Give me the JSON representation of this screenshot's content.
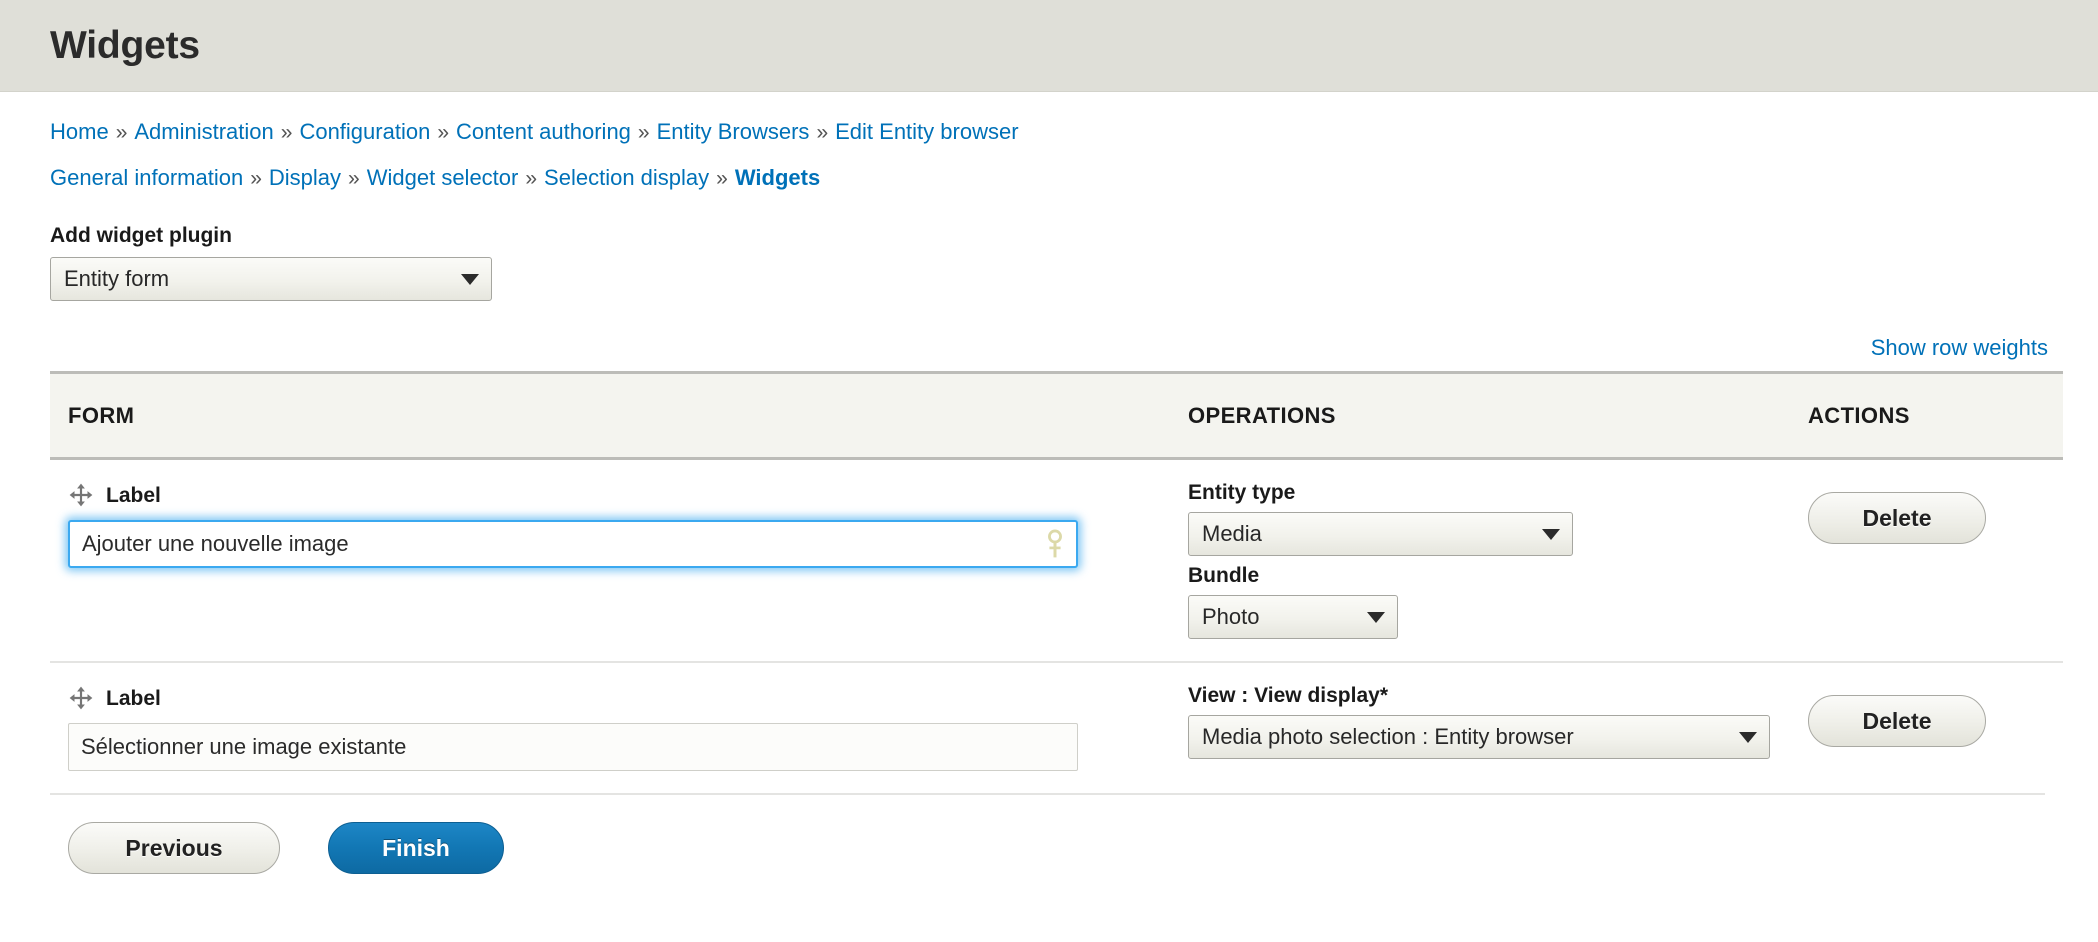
{
  "header": {
    "title": "Widgets"
  },
  "breadcrumb": {
    "separator": "»",
    "row1": [
      {
        "label": "Home",
        "current": false
      },
      {
        "label": "Administration",
        "current": false
      },
      {
        "label": "Configuration",
        "current": false
      },
      {
        "label": "Content authoring",
        "current": false
      },
      {
        "label": "Entity Browsers",
        "current": false
      },
      {
        "label": "Edit Entity browser",
        "current": false
      }
    ],
    "row2": [
      {
        "label": "General information",
        "current": false
      },
      {
        "label": "Display",
        "current": false
      },
      {
        "label": "Widget selector",
        "current": false
      },
      {
        "label": "Selection display",
        "current": false
      },
      {
        "label": "Widgets",
        "current": true
      }
    ]
  },
  "add_widget": {
    "label": "Add widget plugin",
    "select_value": "Entity form",
    "icon": "chevron-down-icon"
  },
  "table": {
    "show_row_weights": "Show row weights",
    "columns": [
      "FORM",
      "OPERATIONS",
      "ACTIONS"
    ],
    "rows": [
      {
        "drag_icon": "move-handle-icon",
        "label_text": "Label",
        "input_value": "Ajouter une nouvelle image",
        "input_placeholder": "",
        "input_focused": true,
        "autofill_icon": "key-icon",
        "operations": [
          {
            "label": "Entity type",
            "required": false,
            "value": "Media",
            "icon": "chevron-down-icon"
          },
          {
            "label": "Bundle",
            "required": false,
            "value": "Photo",
            "icon": "chevron-down-icon"
          }
        ],
        "action_label": "Delete"
      },
      {
        "drag_icon": "move-handle-icon",
        "label_text": "Label",
        "input_value": "Sélectionner une image existante",
        "input_placeholder": "",
        "input_focused": false,
        "autofill_icon": "",
        "operations": [
          {
            "label": "View : View display",
            "required": true,
            "required_mark": "*",
            "value": "Media photo selection : Entity browser",
            "icon": "chevron-down-icon"
          }
        ],
        "action_label": "Delete"
      }
    ]
  },
  "actions": {
    "previous": "Previous",
    "finish": "Finish"
  },
  "colors": {
    "header_bg": "#dfdfd8",
    "link": "#0071b8",
    "primary_button": "#1277b4",
    "required_asterisk": "#e32700",
    "table_head_bg": "#f4f4ef",
    "focus_glow": "#3ba9f0"
  }
}
